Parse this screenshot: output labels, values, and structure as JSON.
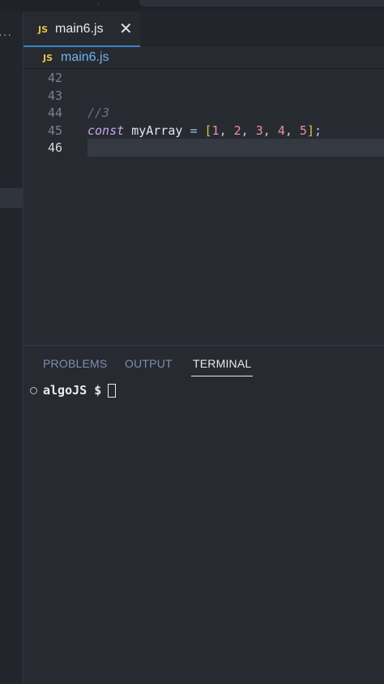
{
  "topbar": {
    "caret": ","
  },
  "activity_bar": {
    "more": "···"
  },
  "tabs": [
    {
      "badge": "JS",
      "title": "main6.js",
      "close": "✕"
    }
  ],
  "breadcrumb": {
    "badge": "JS",
    "file": "main6.js"
  },
  "editor": {
    "lines": [
      {
        "number": "42",
        "tokens": []
      },
      {
        "number": "43",
        "tokens": []
      },
      {
        "number": "44",
        "tokens": [
          {
            "t": "//3",
            "k": "comment"
          }
        ]
      },
      {
        "number": "45",
        "tokens": [
          {
            "t": "const",
            "k": "keyword"
          },
          {
            "t": " ",
            "k": "ident"
          },
          {
            "t": "myArray",
            "k": "ident"
          },
          {
            "t": " ",
            "k": "ident"
          },
          {
            "t": "=",
            "k": "op"
          },
          {
            "t": " ",
            "k": "ident"
          },
          {
            "t": "[",
            "k": "bracket"
          },
          {
            "t": "1",
            "k": "num"
          },
          {
            "t": ", ",
            "k": "punc"
          },
          {
            "t": "2",
            "k": "num"
          },
          {
            "t": ", ",
            "k": "punc"
          },
          {
            "t": "3",
            "k": "num"
          },
          {
            "t": ", ",
            "k": "punc"
          },
          {
            "t": "4",
            "k": "num"
          },
          {
            "t": ", ",
            "k": "punc"
          },
          {
            "t": "5",
            "k": "num"
          },
          {
            "t": "]",
            "k": "bracket"
          },
          {
            "t": ";",
            "k": "punc"
          }
        ]
      },
      {
        "number": "46",
        "tokens": [],
        "current": true
      }
    ]
  },
  "panel": {
    "tabs": [
      {
        "label": "PROBLEMS",
        "active": false
      },
      {
        "label": "OUTPUT",
        "active": false
      },
      {
        "label": "TERMINAL",
        "active": true
      }
    ],
    "terminal": {
      "prompt": "algoJS $"
    }
  },
  "colors": {
    "accent": "#3b82c4",
    "js_badge": "#e5c244",
    "background": "#272a31"
  }
}
